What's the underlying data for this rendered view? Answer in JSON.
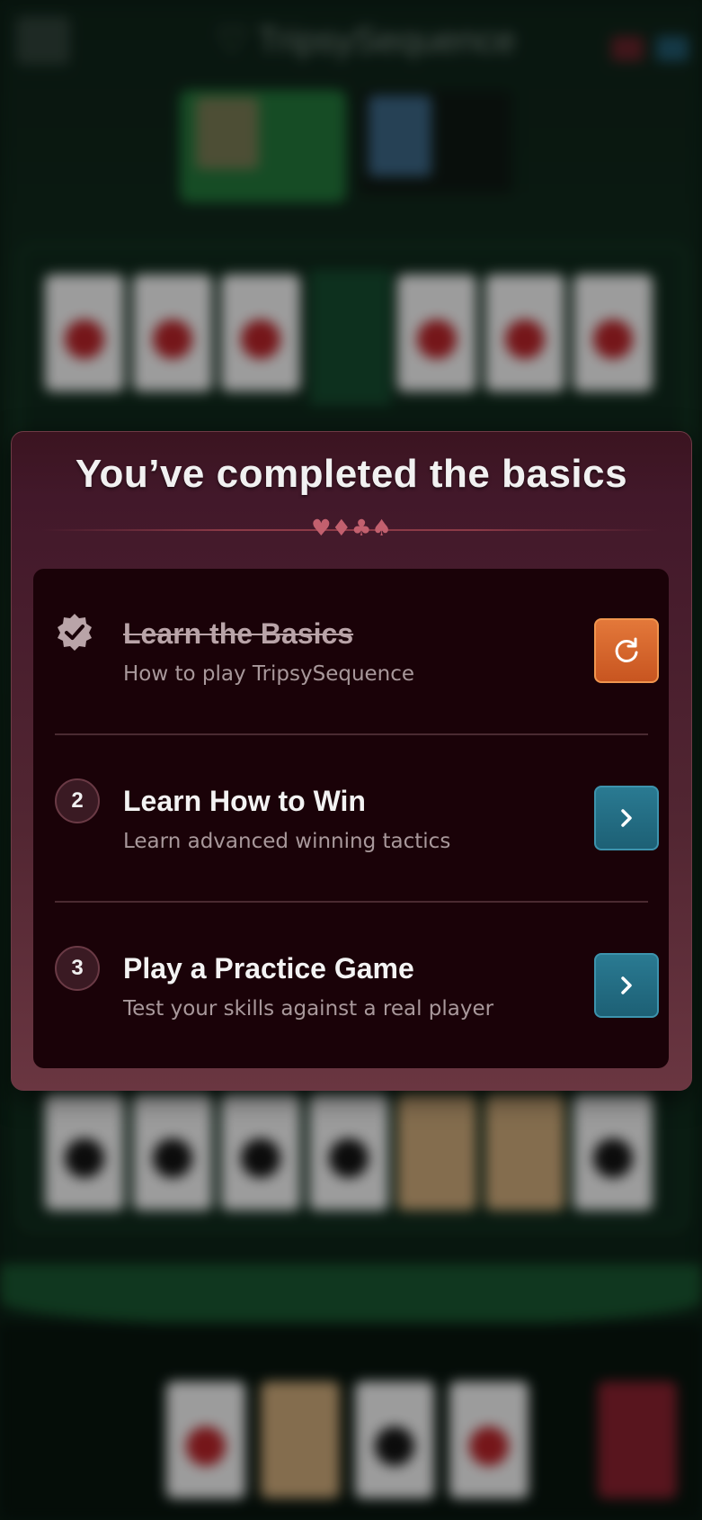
{
  "background": {
    "app_title": "♡ TripsySequence"
  },
  "modal": {
    "title": "You’ve completed the basics",
    "divider_suits": "♥♦♣♠",
    "steps": [
      {
        "status": "completed",
        "icon": "check-badge-icon",
        "title": "Learn the Basics",
        "subtitle": "How to play TripsySequence",
        "action_icon": "replay-icon"
      },
      {
        "number": "2",
        "title": "Learn How to Win",
        "subtitle": "Learn advanced winning tactics",
        "action_icon": "chevron-right-icon"
      },
      {
        "number": "3",
        "title": "Play a Practice Game",
        "subtitle": "Test your skills against a real player",
        "action_icon": "chevron-right-icon"
      }
    ]
  },
  "colors": {
    "modal_bg": "#42182a",
    "list_bg": "#1a0208",
    "replay_button": "#d8672c",
    "next_button": "#26718a",
    "suit_accent": "#c2606e"
  }
}
